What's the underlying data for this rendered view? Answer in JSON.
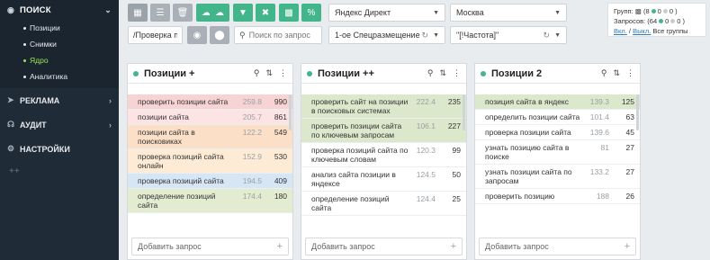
{
  "sidebar": {
    "active_section": {
      "label": "ПОИСК",
      "icon": "eye-icon"
    },
    "subitems": [
      {
        "label": "Позиции",
        "active": false
      },
      {
        "label": "Снимки",
        "active": false
      },
      {
        "label": "Ядро",
        "active": true
      },
      {
        "label": "Аналитика",
        "active": false
      }
    ],
    "sections": [
      {
        "label": "РЕКЛАМА",
        "icon": "compass-icon"
      },
      {
        "label": "АУДИТ",
        "icon": "headset-icon"
      },
      {
        "label": "НАСТРОЙКИ",
        "icon": "gear-icon"
      }
    ],
    "more": "++"
  },
  "toolbar": {
    "engine_select": "Яндекс Директ",
    "region_select": "Москва",
    "project_input": "/Проверка по",
    "search_placeholder": "Поиск по запрос",
    "placement_select": "1-ое Спецразмещение",
    "frequency_select": "\"[!Частота]\""
  },
  "stats": {
    "groups_label": "Групп:",
    "groups_open": "(8",
    "groups_green": "0",
    "groups_gray": "0 )",
    "queries_label": "Запросов:",
    "queries_open": "(64",
    "queries_green": "0",
    "queries_gray": "0 )",
    "on_label": "Вкл.",
    "off_label": "Выкл.",
    "all_groups": "Все группы",
    "slash": "/"
  },
  "panels": [
    {
      "title": "Позиции +",
      "add_placeholder": "Добавить запрос",
      "rows": [
        {
          "query": "проверить позиции сайта",
          "freq": "259.8",
          "count": "990",
          "bg": "#f7d3d3"
        },
        {
          "query": "позиции сайта",
          "freq": "205.7",
          "count": "861",
          "bg": "#fce4e4"
        },
        {
          "query": "позиции сайта в поисковиках",
          "freq": "122.2",
          "count": "549",
          "bg": "#fbdfc6"
        },
        {
          "query": "проверка позиций сайта онлайн",
          "freq": "152.9",
          "count": "530",
          "bg": "#fdebd6"
        },
        {
          "query": "проверка позиций сайта",
          "freq": "194.5",
          "count": "409",
          "bg": "#d6e6f5"
        },
        {
          "query": "определение позиций сайта",
          "freq": "174.4",
          "count": "180",
          "bg": "#e3ecd0"
        }
      ]
    },
    {
      "title": "Позиции ++",
      "add_placeholder": "Добавить запрос",
      "rows": [
        {
          "query": "проверить сайт на позиции в поисковых системах",
          "freq": "222.4",
          "count": "235",
          "bg": "#dce8cb"
        },
        {
          "query": "проверить позиции сайта по ключевым запросам",
          "freq": "106.1",
          "count": "227",
          "bg": "#dce8cb"
        },
        {
          "query": "проверка позиций сайта по ключевым словам",
          "freq": "120.3",
          "count": "99",
          "bg": "#ffffff"
        },
        {
          "query": "анализ сайта позиции в яндексе",
          "freq": "124.5",
          "count": "50",
          "bg": "#ffffff"
        },
        {
          "query": "определение позиций сайта",
          "freq": "124.4",
          "count": "25",
          "bg": "#ffffff"
        }
      ]
    },
    {
      "title": "Позиции 2",
      "add_placeholder": "Добавить запрос",
      "rows": [
        {
          "query": "позиция сайта в яндекс",
          "freq": "139.3",
          "count": "125",
          "bg": "#dce8cb"
        },
        {
          "query": "определить позиции сайта",
          "freq": "101.4",
          "count": "63",
          "bg": "#ffffff"
        },
        {
          "query": "проверка позиции сайта",
          "freq": "139.6",
          "count": "45",
          "bg": "#ffffff"
        },
        {
          "query": "узнать позицию сайта в поиске",
          "freq": "81",
          "count": "27",
          "bg": "#ffffff"
        },
        {
          "query": "узнать позиции сайта по запросам",
          "freq": "133.2",
          "count": "27",
          "bg": "#ffffff"
        },
        {
          "query": "проверить позицию",
          "freq": "188",
          "count": "26",
          "bg": "#ffffff"
        }
      ]
    }
  ]
}
